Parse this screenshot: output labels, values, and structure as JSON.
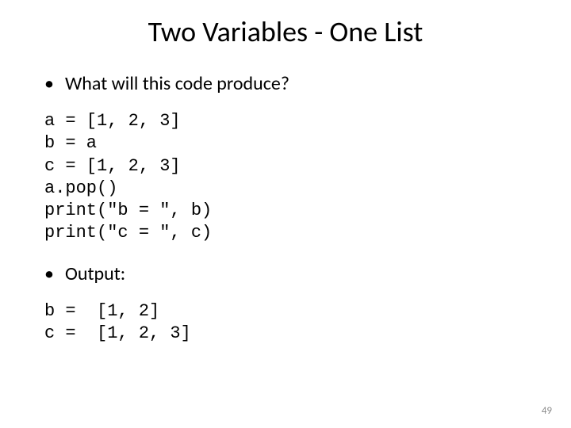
{
  "title": "Two Variables - One List",
  "bullets": {
    "q": "What will this code produce?",
    "out_label": "Output:"
  },
  "code": "a = [1, 2, 3]\nb = a\nc = [1, 2, 3]\na.pop()\nprint(\"b = \", b)\nprint(\"c = \", c)",
  "output": "b =  [1, 2]\nc =  [1, 2, 3]",
  "page_number": "49"
}
